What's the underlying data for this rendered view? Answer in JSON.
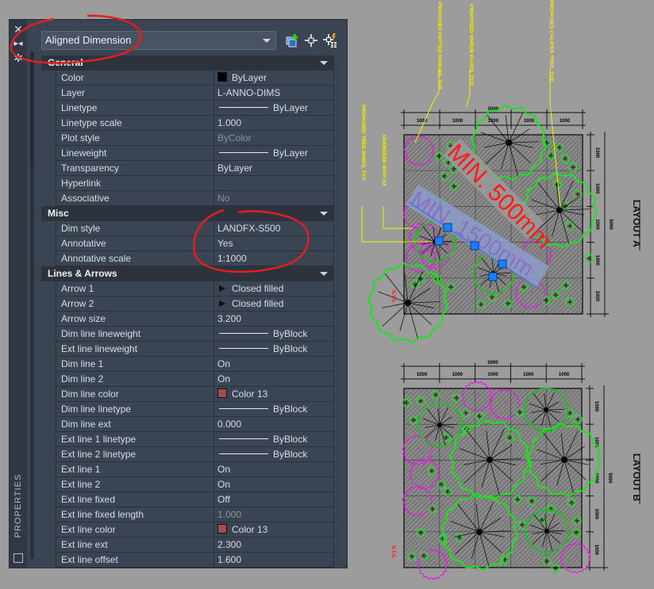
{
  "palette": {
    "vertical_title": "PROPERTIES",
    "titlebar_icons": [
      "close-icon",
      "auto-hide-icon",
      "settings-icon"
    ],
    "object_selector": {
      "value": "Aligned Dimension"
    },
    "toolbar_icons": [
      "toggle-pickadd-icon",
      "select-objects-icon",
      "quick-select-icon"
    ],
    "sections": [
      {
        "title": "General",
        "rows": [
          {
            "label": "Color",
            "value": "ByLayer",
            "swatch": "#000000"
          },
          {
            "label": "Layer",
            "value": "L-ANNO-DIMS"
          },
          {
            "label": "Linetype",
            "value": "ByLayer",
            "linetype": true
          },
          {
            "label": "Linetype scale",
            "value": "1.000"
          },
          {
            "label": "Plot style",
            "value": "ByColor",
            "disabled": true
          },
          {
            "label": "Lineweight",
            "value": "ByLayer",
            "linetype": true
          },
          {
            "label": "Transparency",
            "value": "ByLayer"
          },
          {
            "label": "Hyperlink",
            "value": ""
          },
          {
            "label": "Associative",
            "value": "No",
            "disabled": true
          }
        ]
      },
      {
        "title": "Misc",
        "rows": [
          {
            "label": "Dim style",
            "value": "LANDFX-S500"
          },
          {
            "label": "Annotative",
            "value": "Yes"
          },
          {
            "label": "Annotative scale",
            "value": "1:1000"
          }
        ]
      },
      {
        "title": "Lines & Arrows",
        "rows": [
          {
            "label": "Arrow 1",
            "value": "Closed filled",
            "arrow": true
          },
          {
            "label": "Arrow 2",
            "value": "Closed filled",
            "arrow": true
          },
          {
            "label": "Arrow size",
            "value": "3.200"
          },
          {
            "label": "Dim line lineweight",
            "value": "ByBlock",
            "linetype": true
          },
          {
            "label": "Ext line lineweight",
            "value": "ByBlock",
            "linetype": true
          },
          {
            "label": "Dim line 1",
            "value": "On"
          },
          {
            "label": "Dim line 2",
            "value": "On"
          },
          {
            "label": "Dim line color",
            "value": "Color 13",
            "swatch": "#a0504f"
          },
          {
            "label": "Dim line linetype",
            "value": "ByBlock",
            "linetype": true
          },
          {
            "label": "Dim line ext",
            "value": "0.000"
          },
          {
            "label": "Ext line 1 linetype",
            "value": "ByBlock",
            "linetype": true
          },
          {
            "label": "Ext line 2 linetype",
            "value": "ByBlock",
            "linetype": true
          },
          {
            "label": "Ext line 1",
            "value": "On"
          },
          {
            "label": "Ext line 2",
            "value": "On"
          },
          {
            "label": "Ext line fixed",
            "value": "Off"
          },
          {
            "label": "Ext line fixed length",
            "value": "1.000",
            "disabled": true
          },
          {
            "label": "Ext line color",
            "value": "Color 13",
            "swatch": "#a0504f"
          },
          {
            "label": "Ext line ext",
            "value": "2.300"
          },
          {
            "label": "Ext line offset",
            "value": "1.600"
          }
        ]
      }
    ]
  },
  "drawing": {
    "callouts": [
      "PROPOSED POTTED SHRUBS, TYP.",
      "PROPOSED SHRUB PLUGS, TYP.",
      "PROPOSED CALIPER TREE, TYP.",
      "PROPOSED TREE WHIPS, TYP.",
      "OVERSEED WITH XX"
    ],
    "annotations": {
      "red": "MIN. 500mm",
      "blue": "MIN. 1500mm",
      "nts": "N.T.S."
    },
    "layout_a": {
      "title": "LAYOUT A",
      "total": "5000",
      "segments": [
        "1000",
        "1000",
        "1000",
        "1000",
        "1000"
      ]
    },
    "layout_b": {
      "title": "LAYOUT B",
      "total": "5000",
      "segments": [
        "1000",
        "1000",
        "1000",
        "1000",
        "1000"
      ]
    },
    "colors": {
      "callout": "#f2f200",
      "red_text": "#ff1a1a",
      "blue_text": "#8a6fc9",
      "tree": "#19e619",
      "shrub": "#e619e6",
      "grips": "#1a7fff",
      "markup": "#e01f1f"
    }
  }
}
